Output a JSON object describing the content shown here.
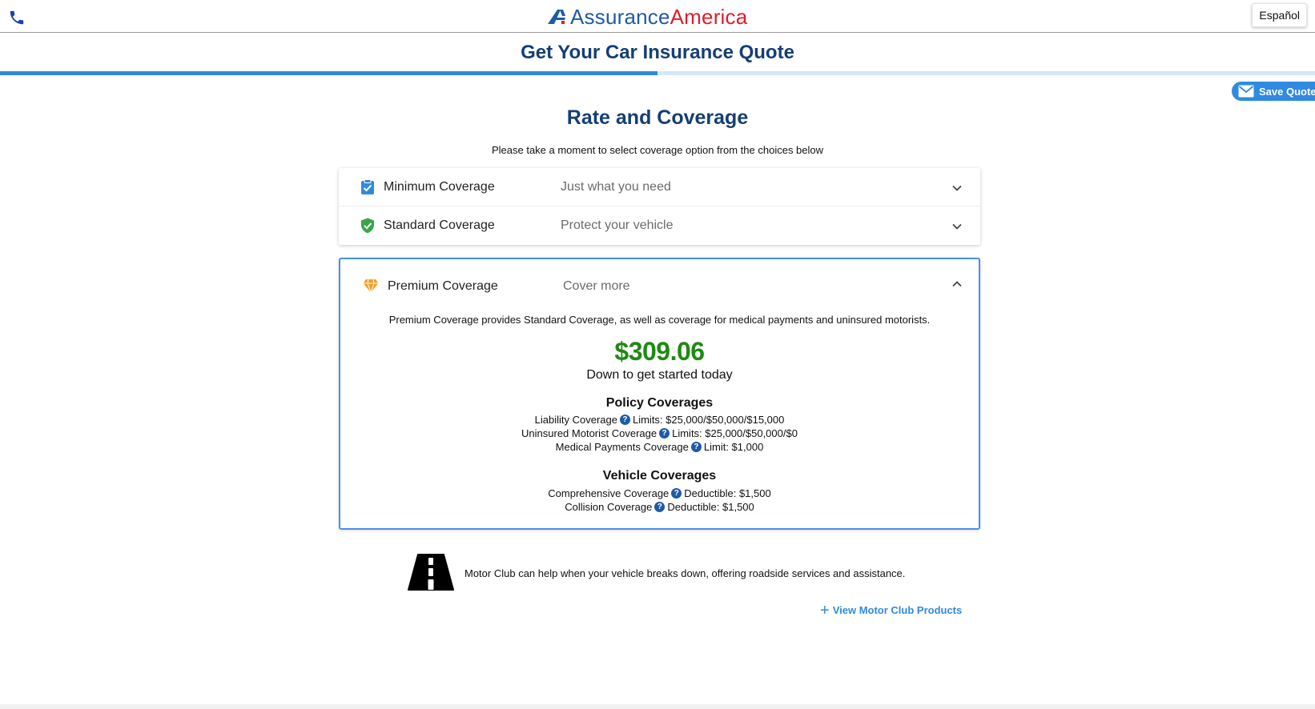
{
  "header": {
    "logo_part1": "Assurance",
    "logo_part2": "America",
    "language_button": "Español"
  },
  "page_title": "Get Your Car Insurance Quote",
  "progress_percent": 50,
  "save_quote_label": "Save Quote",
  "section": {
    "title": "Rate and Coverage",
    "subtitle": "Please take a moment to select coverage option from the choices below"
  },
  "coverages": [
    {
      "name": "Minimum Coverage",
      "description": "Just what you need",
      "icon": "clipboard-check-icon",
      "color": "#2f8ae0",
      "expanded": false
    },
    {
      "name": "Standard Coverage",
      "description": "Protect your vehicle",
      "icon": "shield-check-icon",
      "color": "#3aa64a",
      "expanded": false
    },
    {
      "name": "Premium Coverage",
      "description": "Cover more",
      "icon": "diamond-icon",
      "color": "#f5a023",
      "expanded": true
    }
  ],
  "premium": {
    "description": "Premium Coverage provides Standard Coverage, as well as coverage for medical payments and uninsured motorists.",
    "price": "$309.06",
    "price_caption": "Down to get started today",
    "policy_title": "Policy Coverages",
    "policy_items": [
      {
        "label": "Liability Coverage",
        "value": "Limits: $25,000/$50,000/$15,000"
      },
      {
        "label": "Uninsured Motorist Coverage",
        "value": "Limits: $25,000/$50,000/$0"
      },
      {
        "label": "Medical Payments Coverage",
        "value": "Limit: $1,000"
      }
    ],
    "vehicle_title": "Vehicle Coverages",
    "vehicle_items": [
      {
        "label": "Comprehensive Coverage",
        "value": "Deductible: $1,500"
      },
      {
        "label": "Collision Coverage",
        "value": "Deductible: $1,500"
      }
    ]
  },
  "motor_club": {
    "text": "Motor Club can help when your vehicle breaks down, offering roadside services and assistance.",
    "link": "View Motor Club Products",
    "icon": "road-icon"
  },
  "colors": {
    "primary_dark": "#143f73",
    "accent_blue": "#2f8ae0",
    "price_green": "#1e8a12",
    "brand_red": "#e21b2c"
  }
}
